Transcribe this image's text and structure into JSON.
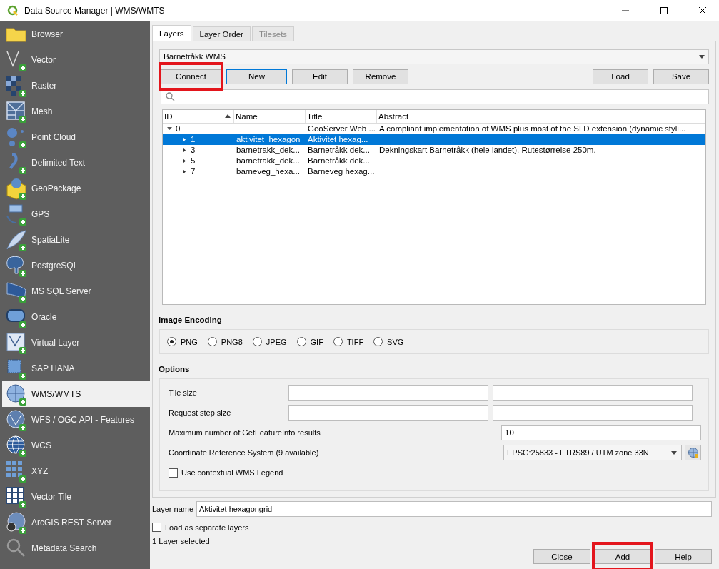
{
  "window": {
    "title": "Data Source Manager | WMS/WMTS"
  },
  "sidebar": {
    "items": [
      {
        "label": "Browser",
        "selected": false
      },
      {
        "label": "Vector",
        "selected": false
      },
      {
        "label": "Raster",
        "selected": false
      },
      {
        "label": "Mesh",
        "selected": false
      },
      {
        "label": "Point Cloud",
        "selected": false
      },
      {
        "label": "Delimited Text",
        "selected": false
      },
      {
        "label": "GeoPackage",
        "selected": false
      },
      {
        "label": "GPS",
        "selected": false
      },
      {
        "label": "SpatiaLite",
        "selected": false
      },
      {
        "label": "PostgreSQL",
        "selected": false
      },
      {
        "label": "MS SQL Server",
        "selected": false
      },
      {
        "label": "Oracle",
        "selected": false
      },
      {
        "label": "Virtual Layer",
        "selected": false
      },
      {
        "label": "SAP HANA",
        "selected": false
      },
      {
        "label": "WMS/WMTS",
        "selected": true
      },
      {
        "label": "WFS / OGC API - Features",
        "selected": false
      },
      {
        "label": "WCS",
        "selected": false
      },
      {
        "label": "XYZ",
        "selected": false
      },
      {
        "label": "Vector Tile",
        "selected": false
      },
      {
        "label": "ArcGIS REST Server",
        "selected": false
      },
      {
        "label": "Metadata Search",
        "selected": false
      }
    ]
  },
  "tabs": [
    {
      "label": "Layers",
      "selected": true,
      "disabled": false
    },
    {
      "label": "Layer Order",
      "selected": false,
      "disabled": false
    },
    {
      "label": "Tilesets",
      "selected": false,
      "disabled": true
    }
  ],
  "connection": {
    "value": "Barnetråkk WMS"
  },
  "connection_buttons": [
    {
      "label": "Connect",
      "highlighted": true,
      "focused": false
    },
    {
      "label": "New",
      "highlighted": false,
      "focused": true
    },
    {
      "label": "Edit",
      "highlighted": false,
      "focused": false
    },
    {
      "label": "Remove",
      "highlighted": false,
      "focused": false
    }
  ],
  "file_buttons": [
    {
      "label": "Load"
    },
    {
      "label": "Save"
    }
  ],
  "layer_tree": {
    "columns": [
      {
        "label": "ID",
        "sorted": true
      },
      {
        "label": "Name",
        "sorted": false
      },
      {
        "label": "Title",
        "sorted": false
      },
      {
        "label": "Abstract",
        "sorted": false
      }
    ],
    "rows": [
      {
        "id": "0",
        "title": "GeoServer Web ...",
        "abstract": "A compliant implementation of WMS plus most of the SLD extension (dynamic styli...",
        "expanded": true,
        "selected": false,
        "children": [
          {
            "id": "1",
            "name": "aktivitet_hexagon",
            "title": "Aktivitet hexag...",
            "expanded": false,
            "selected": true
          },
          {
            "id": "3",
            "name": "barnetrakk_dek...",
            "title": "Barnetråkk dek...",
            "abstract": "Dekningskart Barnetråkk (hele landet). Rutestørrelse 250m.",
            "expanded": false,
            "selected": false
          },
          {
            "id": "5",
            "name": "barnetrakk_dek...",
            "title": "Barnetråkk dek...",
            "expanded": false,
            "selected": false
          },
          {
            "id": "7",
            "name": "barneveg_hexa...",
            "title": "Barneveg hexag...",
            "expanded": false,
            "selected": false
          }
        ]
      }
    ]
  },
  "image_encoding": {
    "title": "Image Encoding",
    "options": [
      {
        "label": "PNG",
        "selected": true
      },
      {
        "label": "PNG8",
        "selected": false
      },
      {
        "label": "JPEG",
        "selected": false
      },
      {
        "label": "GIF",
        "selected": false
      },
      {
        "label": "TIFF",
        "selected": false
      },
      {
        "label": "SVG",
        "selected": false
      }
    ]
  },
  "options": {
    "title": "Options",
    "rows": [
      {
        "kind": "pair",
        "label": "Tile size"
      },
      {
        "kind": "pair",
        "label": "Request step size"
      },
      {
        "kind": "single",
        "label": "Maximum number of GetFeatureInfo results",
        "value": "10"
      },
      {
        "kind": "crs",
        "label": "Coordinate Reference System (9 available)",
        "value": "EPSG:25833 - ETRS89 / UTM zone 33N"
      },
      {
        "kind": "checkbox",
        "label": "Use contextual WMS Legend",
        "checked": false
      }
    ]
  },
  "layer_name": {
    "label": "Layer name",
    "value": "Aktivitet hexagongrid"
  },
  "load_separate": {
    "label": "Load as separate layers",
    "checked": false
  },
  "status": "1 Layer selected",
  "dialog_buttons": [
    {
      "label": "Close",
      "highlighted": false
    },
    {
      "label": "Add",
      "highlighted": true
    },
    {
      "label": "Help",
      "highlighted": false
    }
  ]
}
